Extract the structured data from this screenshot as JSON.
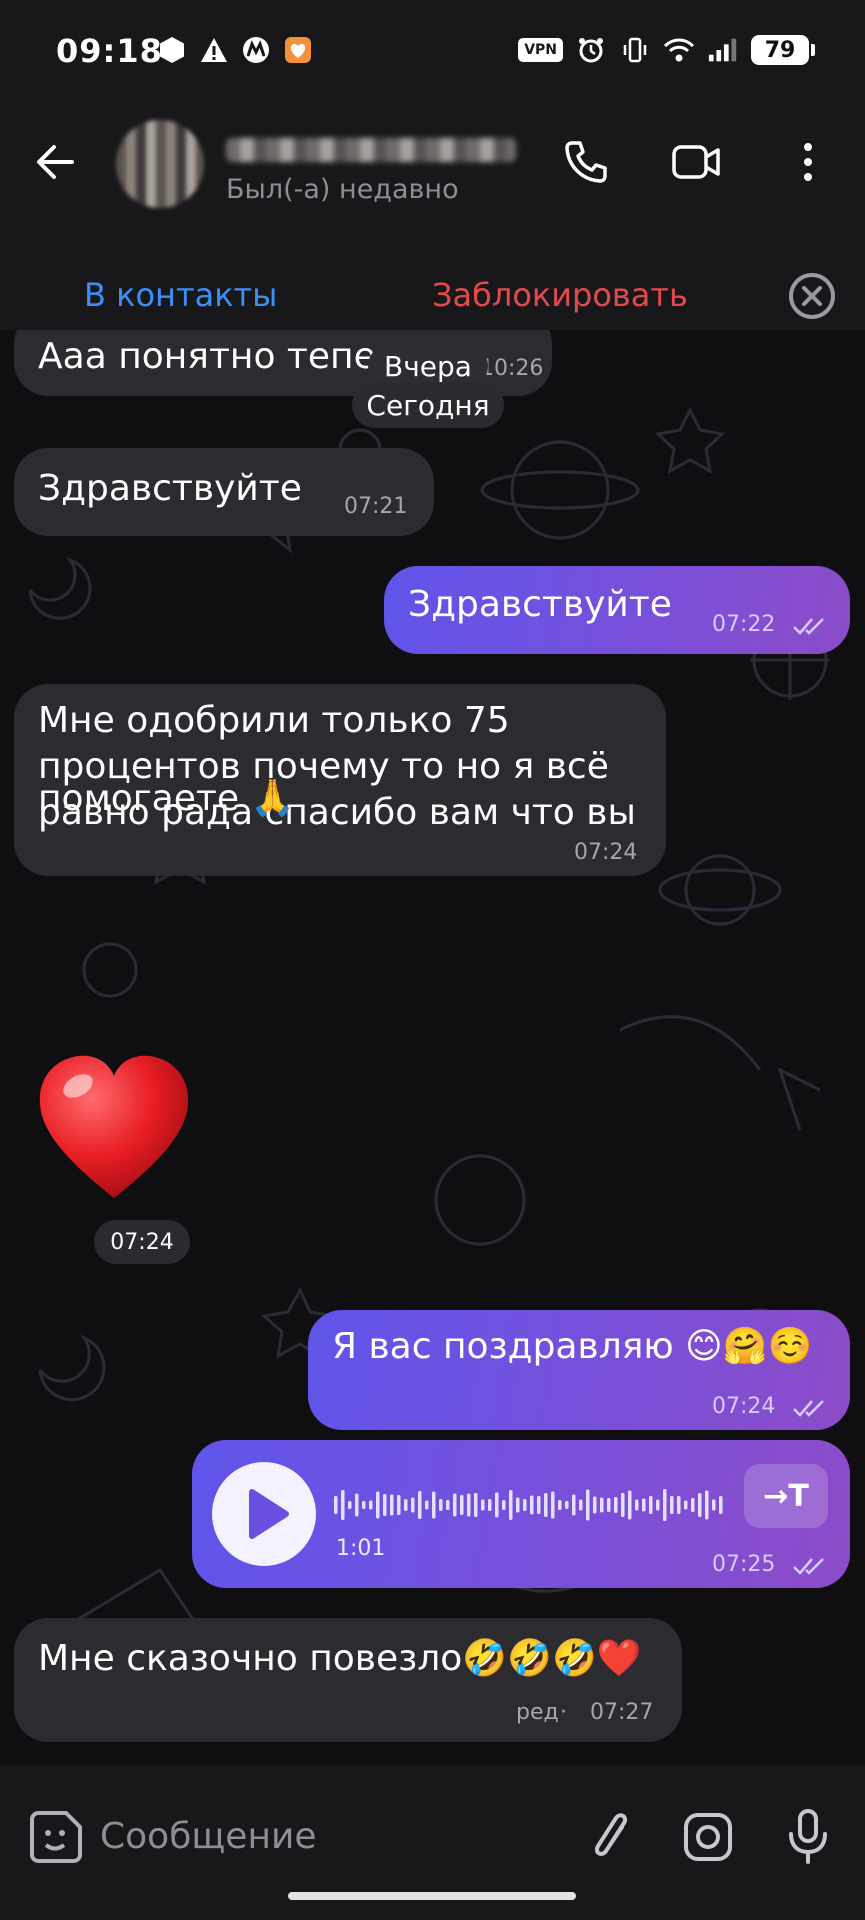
{
  "status_bar": {
    "time": "09:18",
    "vpn": "VPN",
    "battery": "79"
  },
  "header": {
    "contact_name": "",
    "last_seen": "Был(-а) недавно",
    "add_contact": "В контакты",
    "block": "Заблокировать"
  },
  "messages": [
    {
      "direction": "in",
      "text": "Ааа понятно тепе",
      "time": "10:26"
    },
    {
      "type": "date",
      "text": "Вчера"
    },
    {
      "type": "date",
      "text": "Сегодня"
    },
    {
      "direction": "in",
      "text": "Здравствуйте",
      "time": "07:21"
    },
    {
      "direction": "out",
      "text": "Здравствуйте",
      "time": "07:22",
      "read": true
    },
    {
      "direction": "in",
      "lines": [
        "Мне одобрили только 75",
        "процентов почему то но я всё",
        "равно рада спасибо вам что вы",
        "помогаете 🙏"
      ],
      "time": "07:24"
    },
    {
      "direction": "in",
      "type": "sticker",
      "emoji": "heart",
      "time": "07:24"
    },
    {
      "direction": "out",
      "text": "Я вас поздравляю 😊🤗☺️",
      "time": "07:24",
      "read": true
    },
    {
      "direction": "out",
      "type": "voice",
      "duration": "1:01",
      "transcribe_label": "→T",
      "time": "07:25",
      "read": true
    },
    {
      "direction": "in",
      "text": "Мне сказочно повезло🤣🤣🤣❤️",
      "edited_label": "ред",
      "time": "07:27"
    }
  ],
  "input": {
    "placeholder": "Сообщение"
  },
  "icons": {
    "back": "arrow-left-icon",
    "call": "phone-icon",
    "video": "video-camera-icon",
    "menu": "more-vertical-icon",
    "dismiss": "close-circle-icon",
    "sticker": "sticker-icon",
    "attach": "paperclip-icon",
    "camera": "camera-icon",
    "mic": "microphone-icon",
    "play": "play-icon",
    "read": "double-check-icon"
  },
  "colors": {
    "accent_blue": "#3e8ef7",
    "danger_red": "#e5484d",
    "incoming_bubble": "#2b2b30",
    "outgoing_bubble_start": "#5f55ea",
    "outgoing_bubble_end": "#8c4cc8"
  }
}
